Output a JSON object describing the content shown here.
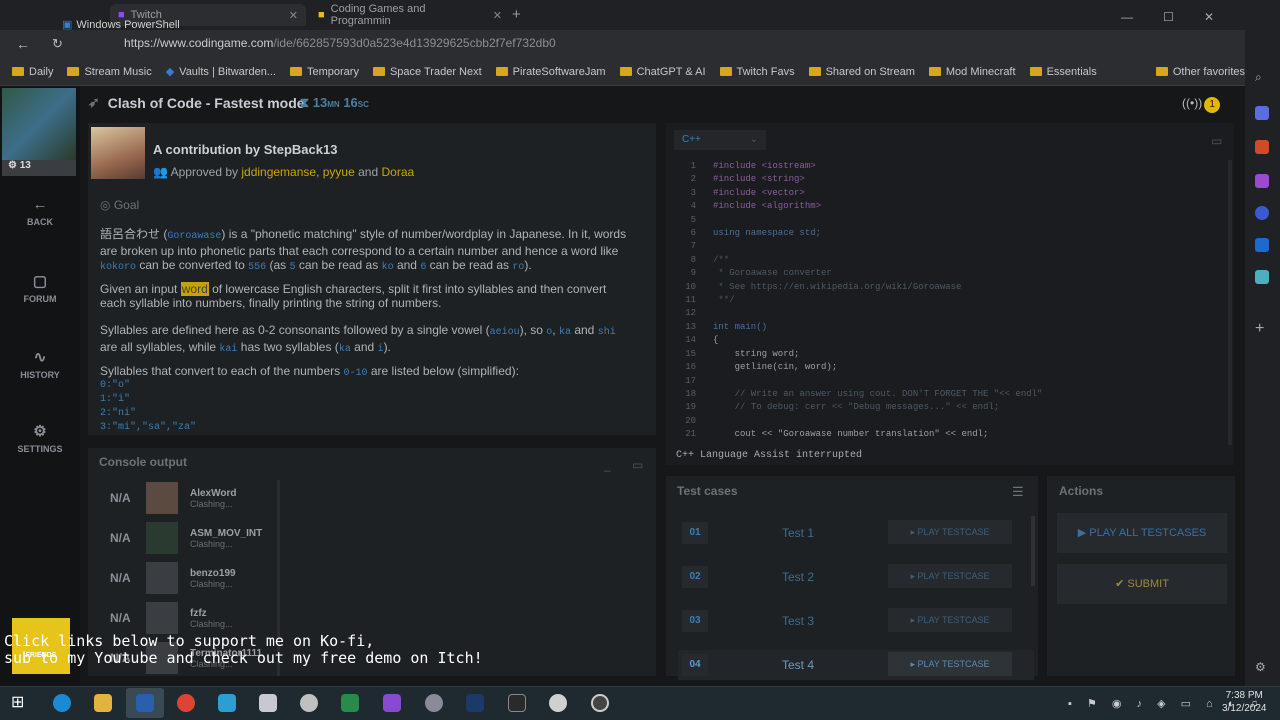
{
  "browser": {
    "tabs": [
      "Twitch",
      "Coding Games and Programmin"
    ],
    "window_title": "Windows PowerShell",
    "url_domain": "https://www.codingame.com",
    "url_path": "/ide/662857593d0a523e4d13929625cbb2f7ef732db0",
    "bookmarks": [
      "Daily",
      "Stream Music",
      "Vaults | Bitwarden...",
      "Temporary",
      "Space Trader Next",
      "PirateSoftwareJam",
      "ChatGPT & AI",
      "Twitch Favs",
      "Shared on Stream",
      "Mod Minecraft",
      "Essentials"
    ],
    "other_favorites": "Other favorites"
  },
  "nav": {
    "level": "13",
    "back": "BACK",
    "forum": "FORUM",
    "history": "HISTORY",
    "settings": "SETTINGS"
  },
  "header": {
    "title": "Clash of Code - Fastest mode",
    "timer_min": "13",
    "timer_min_unit": "MN",
    "timer_sec": "16",
    "timer_sec_unit": "SC",
    "live_count": "1"
  },
  "statement": {
    "contributor": "A contribution by StepBack13",
    "approved_prefix": "Approved by",
    "approvers": [
      "jddingemanse",
      "pyyue",
      "Doraa"
    ],
    "approved_and": "and",
    "goal": "Goal",
    "p1a": "語呂合わせ (",
    "p1_code1": "Goroawase",
    "p1b": ") is a \"phonetic matching\" style of number/wordplay in Japanese. In it, words are broken up into phonetic parts that each correspond to a certain number and hence a word like",
    "p1_code2": "kokoro",
    "p1c": "can be converted to",
    "p1_code3": "556",
    "p1d": "(as",
    "p1_code4": "5",
    "p1e": "can be read as",
    "p1_code5": "ko",
    "p1f": "and",
    "p1_code6": "6",
    "p1g": "can be read as",
    "p1_code7": "ro",
    "p1h": ").",
    "p2a": "Given an input",
    "p2_hl": "word",
    "p2b": "of lowercase English characters, split it first into syllables and then convert each syllable into numbers, finally printing the string of numbers.",
    "p3a": "Syllables are defined here as 0-2 consonants followed by a single vowel (",
    "p3_code1": "aeiou",
    "p3b": "), so",
    "p3_code2": "o",
    "p3_code3": "ka",
    "p3c": "and",
    "p3_code4": "shi",
    "p3d": "are all syllables, while",
    "p3_code5": "kai",
    "p3e": "has two syllables (",
    "p3_code6": "ka",
    "p3f": "and",
    "p3_code7": "i",
    "p3g": ").",
    "p4a": "Syllables that convert to each of the numbers",
    "p4_code": "0-10",
    "p4b": "are listed below (simplified):",
    "list": [
      "0:\"o\"",
      "1:\"i\"",
      "2:\"ni\"",
      "3:\"mi\",\"sa\",\"za\""
    ]
  },
  "editor": {
    "language": "C++",
    "lines": [
      "#include <iostream>",
      "#include <string>",
      "#include <vector>",
      "#include <algorithm>",
      "",
      "using namespace std;",
      "",
      "/**",
      " * Goroawase converter",
      " * See https://en.wikipedia.org/wiki/Goroawase",
      " **/",
      "",
      "int main()",
      "{",
      "    string word;",
      "    getline(cin, word);",
      "",
      "    // Write an answer using cout. DON'T FORGET THE \"<< endl\"",
      "    // To debug: cerr << \"Debug messages...\" << endl;",
      "",
      "    cout << \"Goroawase number translation\" << endl;"
    ],
    "assist": "C++ Language Assist interrupted"
  },
  "console": {
    "title": "Console output",
    "players": [
      {
        "rank": "N/A",
        "name": "AlexWord",
        "status": "Clashing..."
      },
      {
        "rank": "N/A",
        "name": "ASM_MOV_INT",
        "status": "Clashing..."
      },
      {
        "rank": "N/A",
        "name": "benzo199",
        "status": "Clashing..."
      },
      {
        "rank": "N/A",
        "name": "fzfz",
        "status": "Clashing..."
      },
      {
        "rank": "N/A",
        "name": "Terminator1111",
        "status": "Clashing..."
      }
    ]
  },
  "tests": {
    "title": "Test cases",
    "items": [
      {
        "num": "01",
        "name": "Test 1",
        "button": "▸ PLAY TESTCASE"
      },
      {
        "num": "02",
        "name": "Test 2",
        "button": "▸ PLAY TESTCASE"
      },
      {
        "num": "03",
        "name": "Test 3",
        "button": "▸ PLAY TESTCASE"
      },
      {
        "num": "04",
        "name": "Test 4",
        "button": "▸ PLAY TESTCASE"
      }
    ]
  },
  "actions": {
    "title": "Actions",
    "play_all": "▶ PLAY ALL TESTCASES",
    "submit": "✔ SUBMIT"
  },
  "overlay": {
    "line1": "Click links below to support me on Ko-fi,",
    "line2": "sub to my Youtube and check out my free demo on Itch!",
    "friends": "FRIENDS"
  },
  "taskbar": {
    "time": "7:38 PM",
    "date": "3/12/2024"
  }
}
